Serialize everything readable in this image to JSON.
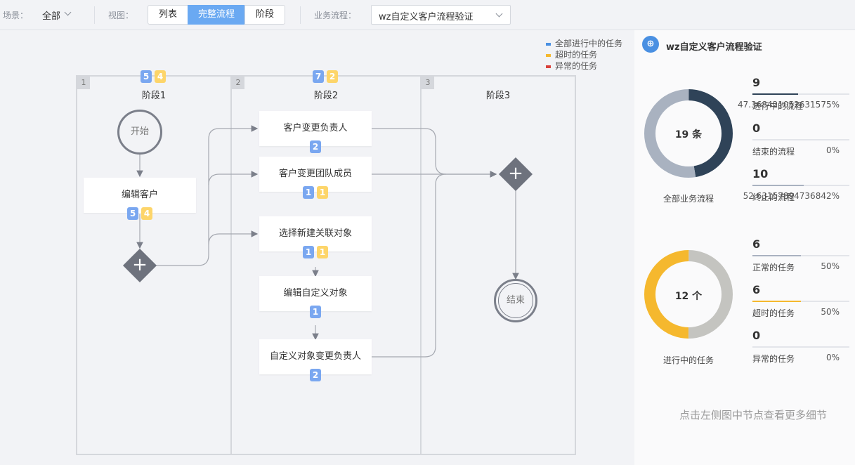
{
  "toolbar": {
    "scene_label": "场景：",
    "scene_value": "全部",
    "view_label": "视图：",
    "view_tabs": [
      "列表",
      "完整流程",
      "阶段"
    ],
    "active_view": "完整流程",
    "flow_label": "业务流程：",
    "flow_value": "wz自定义客户流程验证"
  },
  "legend": [
    {
      "label": "全部进行中的任务",
      "color": "#4a90e2"
    },
    {
      "label": "超时的任务",
      "color": "#f5b82e"
    },
    {
      "label": "异常的任务",
      "color": "#d9403a"
    }
  ],
  "lanes": [
    {
      "num": "1",
      "title": "阶段1",
      "badges": [
        "5",
        "4"
      ]
    },
    {
      "num": "2",
      "title": "阶段2",
      "badges": [
        "7",
        "2"
      ]
    },
    {
      "num": "3",
      "title": "阶段3",
      "badges": []
    }
  ],
  "events": {
    "start": "开始",
    "end": "结束"
  },
  "nodes": [
    {
      "label": "编辑客户",
      "blue": "5",
      "yellow": "4"
    },
    {
      "label": "客户变更负责人",
      "blue": "2",
      "yellow": ""
    },
    {
      "label": "客户变更团队成员",
      "blue": "1",
      "yellow": "1"
    },
    {
      "label": "选择新建关联对象",
      "blue": "1",
      "yellow": "1"
    },
    {
      "label": "编辑自定义对象",
      "blue": "1",
      "yellow": ""
    },
    {
      "label": "自定义对象变更负责人",
      "blue": "2",
      "yellow": ""
    }
  ],
  "panel": {
    "icon": "flow-icon",
    "title": "wz自定义客户流程验证",
    "flows": {
      "center": "19 条",
      "label": "全部业务流程",
      "stats": [
        {
          "count": "9",
          "name": "进行中的流程",
          "pct": "47.368421052631575%",
          "fraction": 0.47,
          "color": "#2f4358"
        },
        {
          "count": "0",
          "name": "结束的流程",
          "pct": "0%",
          "fraction": 0,
          "color": "#2f4358"
        },
        {
          "count": "10",
          "name": "终止的流程",
          "pct": "52.63157894736842%",
          "fraction": 0.53,
          "color": "#a9b2c0"
        }
      ],
      "segments": [
        {
          "value": 9,
          "color": "#2f4358"
        },
        {
          "value": 10,
          "color": "#a9b2c0"
        }
      ]
    },
    "tasks": {
      "center": "12 个",
      "label": "进行中的任务",
      "stats": [
        {
          "count": "6",
          "name": "正常的任务",
          "pct": "50%",
          "fraction": 0.5,
          "color": "#a9b2c0"
        },
        {
          "count": "6",
          "name": "超时的任务",
          "pct": "50%",
          "fraction": 0.5,
          "color": "#f5b82e"
        },
        {
          "count": "0",
          "name": "异常的任务",
          "pct": "0%",
          "fraction": 0,
          "color": "#d9403a"
        }
      ],
      "segments": [
        {
          "value": 6,
          "color": "#c4c4c0"
        },
        {
          "value": 6,
          "color": "#f5b82e"
        }
      ]
    },
    "hint": "点击左侧图中节点查看更多细节"
  }
}
